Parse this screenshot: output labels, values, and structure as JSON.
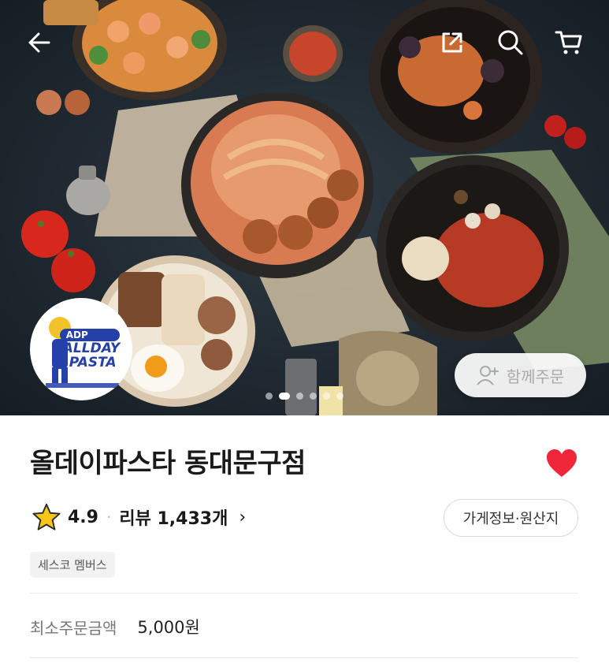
{
  "hero": {
    "logo": {
      "badge": "ADP",
      "line1": "ALLDAY",
      "line2": "PASTA"
    },
    "together_order_label": "함께주문",
    "carousel": {
      "total": 6,
      "active": 2
    },
    "icons": {
      "back": "back-arrow-icon",
      "share": "share-icon",
      "search": "search-icon",
      "cart": "cart-icon"
    }
  },
  "store": {
    "name": "올데이파스타 동대문구점",
    "rating": "4.9",
    "review_label": "리뷰 1,433개",
    "info_button": "가게정보·원산지",
    "tag": "세스코 멤버스",
    "min_order_label": "최소주문금액",
    "min_order_value": "5,000원"
  },
  "colors": {
    "heart": "#f0263b",
    "star": "#f5c518",
    "logo_blue": "#2540a8"
  }
}
